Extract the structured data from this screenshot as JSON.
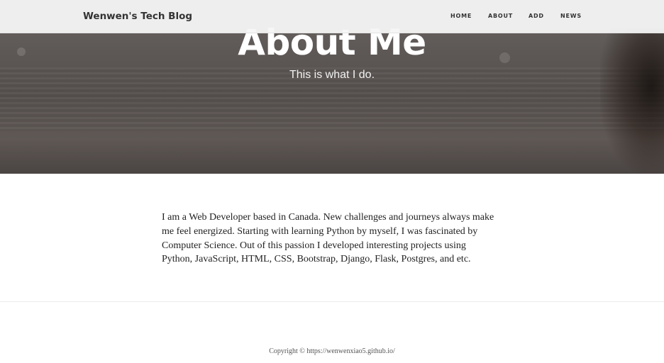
{
  "navbar": {
    "brand": "Wenwen's Tech Blog",
    "links": [
      {
        "label": "HOME"
      },
      {
        "label": "ABOUT"
      },
      {
        "label": "ADD"
      },
      {
        "label": "NEWS"
      }
    ]
  },
  "hero": {
    "title": "About Me",
    "subtitle": "This is what I do."
  },
  "main": {
    "paragraph": "I am a Web Developer based in Canada. New challenges and journeys always make me feel energized. Starting with learning Python by myself, I was fascinated by Computer Science. Out of this passion I developed interesting projects using Python, JavaScript, HTML, CSS, Bootstrap, Django, Flask, Postgres, and etc."
  },
  "footer": {
    "copyright": "Copyright © https://wenwenxiao5.github.io/"
  }
}
